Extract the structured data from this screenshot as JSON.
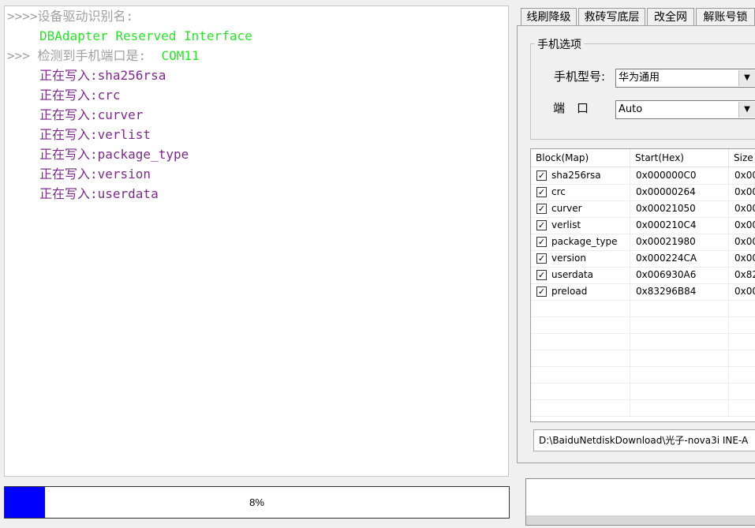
{
  "log": {
    "lines": [
      {
        "prefix": ">>>>",
        "text": "设备驱动识别名:",
        "style": "gray"
      },
      {
        "prefix": "",
        "text": "DBAdapter Reserved Interface",
        "style": "green"
      },
      {
        "prefix": ">>>",
        "text": " 检测到手机端口是:",
        "value": "COM11",
        "style": "gray"
      },
      {
        "prefix": "",
        "text": "正在写入:sha256rsa",
        "style": "purple"
      },
      {
        "prefix": "",
        "text": "正在写入:crc",
        "style": "purple"
      },
      {
        "prefix": "",
        "text": "正在写入:curver",
        "style": "purple"
      },
      {
        "prefix": "",
        "text": "正在写入:verlist",
        "style": "purple"
      },
      {
        "prefix": "",
        "text": "正在写入:package_type",
        "style": "purple"
      },
      {
        "prefix": "",
        "text": "正在写入:version",
        "style": "purple"
      },
      {
        "prefix": "",
        "text": "正在写入:userdata",
        "style": "purple"
      }
    ]
  },
  "progress": {
    "label": "8%",
    "value": 0.08,
    "color": "#0000ff"
  },
  "tabs": [
    "线刷降级",
    "救砖写底层",
    "改全网",
    "解账号锁"
  ],
  "phone_options": {
    "group_title": "手机选项",
    "model_label": "手机型号:",
    "model_value": "华为通用",
    "port_label": "端　口",
    "port_value": "Auto"
  },
  "blocks": {
    "columns": [
      "Block(Map)",
      "Start(Hex)",
      "Size"
    ],
    "rows": [
      {
        "name": "sha256rsa",
        "start": "0x000000C0",
        "size": "0x00",
        "checked": true
      },
      {
        "name": "crc",
        "start": "0x00000264",
        "size": "0x00",
        "checked": true
      },
      {
        "name": "curver",
        "start": "0x00021050",
        "size": "0x00",
        "checked": true
      },
      {
        "name": "verlist",
        "start": "0x000210C4",
        "size": "0x00",
        "checked": true
      },
      {
        "name": "package_type",
        "start": "0x00021980",
        "size": "0x00",
        "checked": true
      },
      {
        "name": "version",
        "start": "0x000224CA",
        "size": "0x00",
        "checked": true
      },
      {
        "name": "userdata",
        "start": "0x006930A6",
        "size": "0x82",
        "checked": true
      },
      {
        "name": "preload",
        "start": "0x83296B84",
        "size": "0x00",
        "checked": true
      }
    ]
  },
  "file_path": "D:\\BaiduNetdiskDownload\\光子-nova3i INE-A",
  "colors": {
    "log_gray": "#a0a0a0",
    "log_green": "#2ee02e",
    "log_purple": "#7b2a8a"
  }
}
